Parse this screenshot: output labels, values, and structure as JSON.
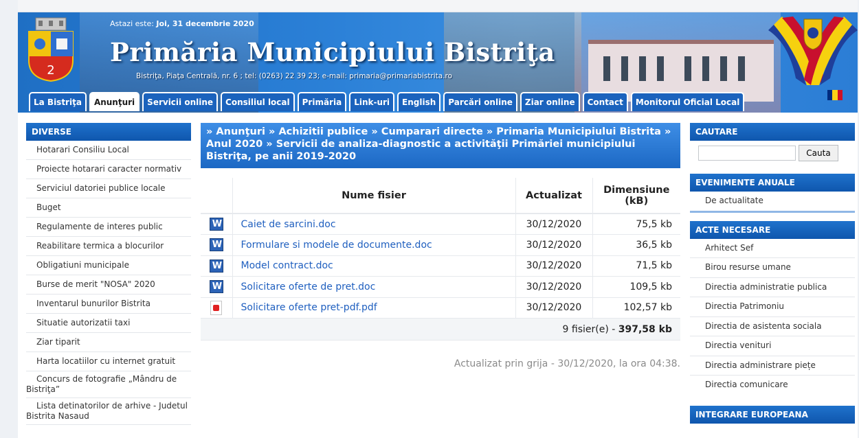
{
  "header": {
    "date_prefix": "Astazi este: ",
    "date_value": "Joi, 31 decembrie 2020",
    "title": "Primăria Municipiului Bistriţa",
    "address": "Bistriţa, Piaţa Centrală, nr. 6 ; tel: (0263) 22 39 23; e-mail: primaria@primariabistrita.ro",
    "tabs": [
      {
        "label": "La Bistriţa"
      },
      {
        "label": "Anunţuri"
      },
      {
        "label": "Servicii online"
      },
      {
        "label": "Consiliul local"
      },
      {
        "label": "Primăria"
      },
      {
        "label": "Link-uri"
      },
      {
        "label": "English"
      },
      {
        "label": "Parcări online"
      },
      {
        "label": "Ziar online"
      },
      {
        "label": "Contact"
      },
      {
        "label": "Monitorul Oficial Local"
      }
    ],
    "active_tab": "Anunţuri",
    "colors": {
      "header_blue": "#2a7fd6",
      "tab_blue": "#1b63bd"
    }
  },
  "sidebar": {
    "title": "DIVERSE",
    "items": [
      {
        "label": "Hotarari Consiliu Local"
      },
      {
        "label": "Proiecte hotarari caracter normativ"
      },
      {
        "label": "Serviciul datoriei publice locale"
      },
      {
        "label": "Buget"
      },
      {
        "label": "Regulamente de interes public"
      },
      {
        "label": "Reabilitare termica a blocurilor"
      },
      {
        "label": "Obligatiuni municipale"
      },
      {
        "label": "Burse de merit \"NOSA\" 2020"
      },
      {
        "label": "Inventarul bunurilor Bistrita"
      },
      {
        "label": "Situatie autorizatii taxi"
      },
      {
        "label": "Ziar tiparit"
      },
      {
        "label": "Harta locatiilor cu internet gratuit"
      },
      {
        "label": "Concurs de fotografie „Mândru de Bistriţa”"
      },
      {
        "label": "Lista detinatorilor de arhive - Judetul Bistrita Nasaud"
      }
    ]
  },
  "main": {
    "breadcrumb": "» Anunţuri » Achizitii publice » Cumparari directe » Primaria Municipiului Bistrita » Anul 2020 » Servicii de analiza-diagnostic a activităţii Primăriei municipiului Bistriţa, pe anii 2019-2020",
    "table": {
      "headers": {
        "name": "Nume fisier",
        "updated": "Actualizat",
        "size": "Dimensiune (kB)"
      },
      "rows": [
        {
          "icon": "word-doc-icon",
          "name": "Caiet de sarcini.doc",
          "updated": "30/12/2020",
          "size": "75,5 kb"
        },
        {
          "icon": "word-doc-icon",
          "name": "Formulare si modele de documente.doc",
          "updated": "30/12/2020",
          "size": "36,5 kb"
        },
        {
          "icon": "word-doc-icon",
          "name": "Model contract.doc",
          "updated": "30/12/2020",
          "size": "71,5 kb"
        },
        {
          "icon": "word-doc-icon",
          "name": "Solicitare oferte de pret.doc",
          "updated": "30/12/2020",
          "size": "109,5 kb"
        },
        {
          "icon": "pdf-icon",
          "name": "Solicitare oferte pret-pdf.pdf",
          "updated": "30/12/2020",
          "size": "102,57 kb"
        }
      ],
      "summary_prefix": "9 fisier(e) - ",
      "summary_total": "397,58 kb"
    },
    "updated_note": "Actualizat prin grija - 30/12/2020, la ora 04:38."
  },
  "right": {
    "search": {
      "title": "CAUTARE",
      "placeholder": "",
      "button_label": "Cauta"
    },
    "events": {
      "title": "EVENIMENTE ANUALE",
      "items": [
        {
          "label": "De actualitate"
        }
      ]
    },
    "acts": {
      "title": "ACTE NECESARE",
      "items": [
        {
          "label": "Arhitect Sef"
        },
        {
          "label": "Birou resurse umane"
        },
        {
          "label": "Directia administratie publica"
        },
        {
          "label": "Directia Patrimoniu"
        },
        {
          "label": "Directia de asistenta sociala"
        },
        {
          "label": "Directia venituri"
        },
        {
          "label": "Directia administrare piețe"
        },
        {
          "label": "Directia comunicare"
        }
      ]
    },
    "eu": {
      "title": "INTEGRARE EUROPEANA"
    }
  }
}
